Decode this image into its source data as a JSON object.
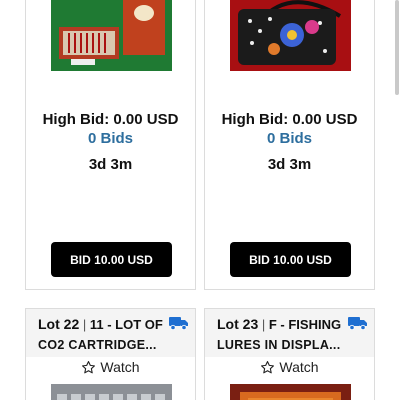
{
  "cards_top": [
    {
      "image_icon": "ornaments-box-photo",
      "high_bid": "High Bid: 0.00 USD",
      "bids": "0 Bids",
      "time_left": "3d 3m",
      "bid_button": "BID 10.00 USD"
    },
    {
      "image_icon": "beaded-handbag-photo",
      "high_bid": "High Bid: 0.00 USD",
      "bids": "0 Bids",
      "time_left": "3d 3m",
      "bid_button": "BID 10.00 USD"
    }
  ],
  "cards_bottom": [
    {
      "lot_label": "Lot 22",
      "lot_sep": "|",
      "lot_title_1": "11 - LOT OF",
      "lot_title_2": "CO2 CARTRIDGE...",
      "watch_label": "Watch",
      "shipping_icon": "truck-icon"
    },
    {
      "lot_label": "Lot 23",
      "lot_sep": "|",
      "lot_title_1": "F - FISHING",
      "lot_title_2": "LURES IN DISPLA...",
      "watch_label": "Watch",
      "shipping_icon": "truck-icon"
    }
  ],
  "colors": {
    "bids_link": "#2d6e9e",
    "button_bg": "#000000",
    "shipping_icon": "#1f6fd1"
  }
}
